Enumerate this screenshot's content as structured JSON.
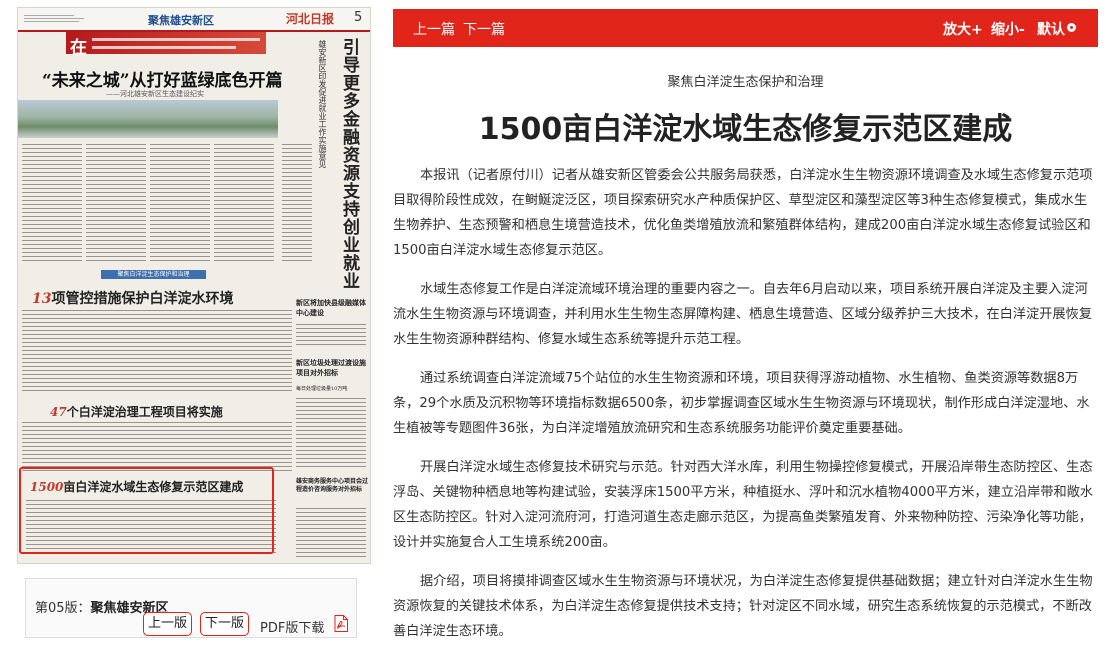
{
  "toolbar": {
    "prev_article": "上一篇",
    "next_article": "下一篇",
    "zoom_in": "放大+",
    "zoom_out": "缩小-",
    "reset": "默认"
  },
  "colors": {
    "accent": "#e1251b",
    "section_blue": "#1f4f8c",
    "text": "#333333"
  },
  "article": {
    "kicker": "聚焦白洋淀生态保护和治理",
    "title": "1500亩白洋淀水域生态修复示范区建成",
    "paragraphs": [
      "本报讯（记者原付川）记者从雄安新区管委会公共服务局获悉，白洋淀水生生物资源环境调查及水域生态修复示范项目取得阶段性成效，在鲥鯅淀泛区，项目探索研究水产种质保护区、草型淀区和藻型淀区等3种生态修复模式，集成水生生物养护、生态预警和栖息生境营造技术，优化鱼类增殖放流和繁殖群体结构，建成200亩白洋淀水域生态修复试验区和1500亩白洋淀水域生态修复示范区。",
      "水域生态修复工作是白洋淀流域环境治理的重要内容之一。自去年6月启动以来，项目系统开展白洋淀及主要入淀河流水生生物资源与环境调查，并利用水生生物生态屏障构建、栖息生境营造、区域分级养护三大技术，在白洋淀开展恢复水生生物资源种群结构、修复水域生态系统等提升示范工程。",
      "通过系统调查白洋淀流域75个站位的水生生物资源和环境，项目获得浮游动植物、水生植物、鱼类资源等数据8万条，29个水质及沉积物等环境指标数据6500条，初步掌握调查区域水生生物资源与环境现状，制作形成白洋淀湿地、水生植被等专题图件36张，为白洋淀增殖放流研究和生态系统服务功能评价奠定重要基础。",
      "开展白洋淀水域生态修复技术研究与示范。针对西大洋水库，利用生物操控修复模式，开展沿岸带生态防控区、生态浮岛、关键物种栖息地等构建试验，安装浮床1500平方米，种植挺水、浮叶和沉水植物4000平方米，建立沿岸带和敞水区生态防控区。针对入淀河流府河，打造河道生态走廊示范区，为提高鱼类繁殖发育、外来物种防控、污染净化等功能，设计并实施复合人工生境系统200亩。",
      "据介绍，项目将摸排调查区域水生生物资源与环境状况，为白洋淀生态修复提供基础数据；建立针对白洋淀水生生物资源恢复的关键技术体系，为白洋淀生态修复提供技术支持；针对淀区不同水域，研究生态系统恢复的示范模式，不断改善白洋淀生态环境。"
    ]
  },
  "edition": {
    "label": "第05版：",
    "name": "聚焦雄安新区",
    "prev_page": "上一版",
    "next_page": "下一版",
    "pdf": "PDF版下载",
    "pdf_icon": "pdf-file-icon"
  },
  "thumbnail": {
    "section": "聚焦雄安新区",
    "logo": "河北日报",
    "page_number": "5",
    "banner": "在",
    "lead_headline": "“未来之城”从打好蓝绿底色开篇",
    "lead_sub": "——河北雄安新区生态建设纪实",
    "vertical_headline": "引导更多金融资源支持创业就业",
    "vertical_sub": "雄安新区印发促进就业工作实施意见",
    "blue_label": "聚焦白洋淀生态保护和治理",
    "item1": {
      "num": "13",
      "text": "项管控措施保护白洋淀水环境"
    },
    "item2": {
      "num": "47",
      "text": "个白洋淀治理工程项目将实施"
    },
    "item3": {
      "num": "1500",
      "text": "亩白洋淀水域生态修复示范区建成"
    },
    "side1": "新区将加快县级融媒体中心建设",
    "side2": "新区垃圾处理过渡设施项目对外招标",
    "side2_sub": "每日处理垃圾量10万吨",
    "side3": "雄安商务服务中心项目会过程造价咨询服务对外招标"
  }
}
